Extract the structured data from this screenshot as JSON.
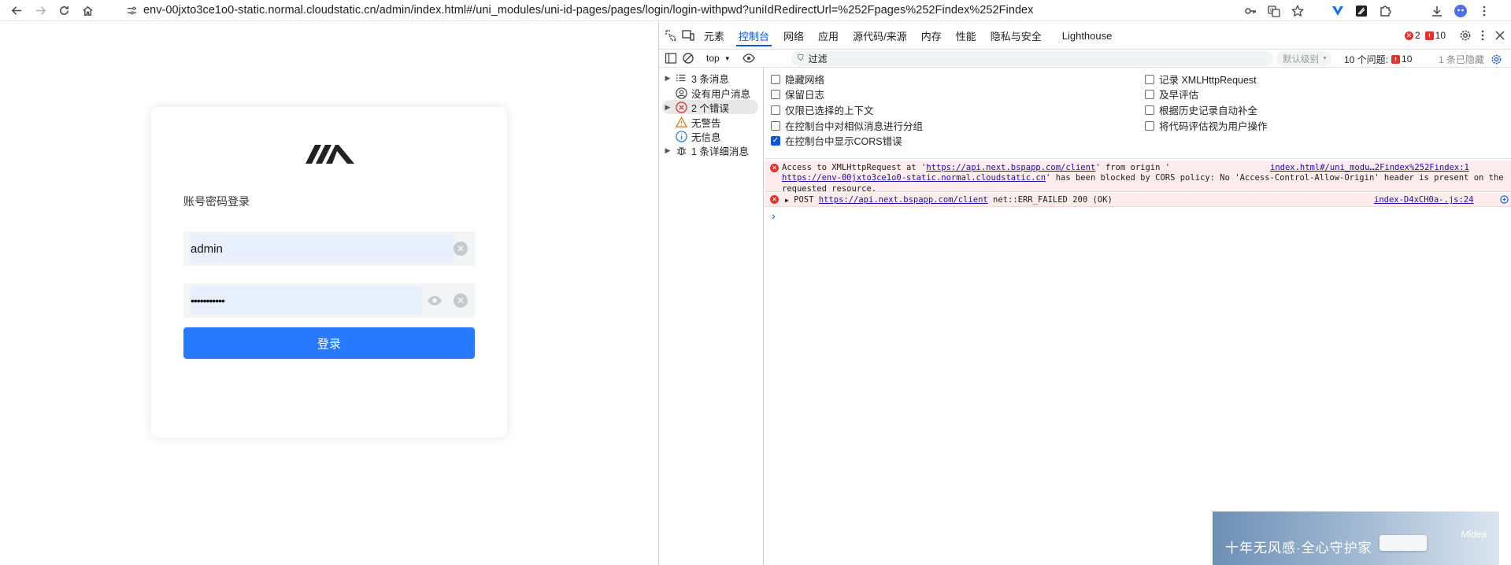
{
  "browser": {
    "url": "env-00jxto3ce1o0-static.normal.cloudstatic.cn/admin/index.html#/uni_modules/uni-id-pages/pages/login/login-withpwd?uniIdRedirectUrl=%252Fpages%252Findex%252Findex",
    "toolbar_icons": [
      "back-icon",
      "forward-icon",
      "reload-icon",
      "home-icon",
      "site-info-icon",
      "password-key-icon",
      "translate-icon",
      "bookmark-star-icon",
      "extension-v-icon",
      "extension-edit-icon",
      "extensions-puzzle-icon",
      "download-icon",
      "profile-avatar-icon",
      "menu-icon"
    ]
  },
  "login": {
    "title": "账号密码登录",
    "username_value": "admin",
    "password_value": "•••••••••••",
    "button_label": "登录",
    "accent_color": "#2979ff"
  },
  "devtools": {
    "tabs": [
      {
        "label": "元素",
        "active": false
      },
      {
        "label": "控制台",
        "active": true
      },
      {
        "label": "网络",
        "active": false
      },
      {
        "label": "应用",
        "active": false
      },
      {
        "label": "源代码/来源",
        "active": false
      },
      {
        "label": "内存",
        "active": false
      },
      {
        "label": "性能",
        "active": false
      },
      {
        "label": "隐私与安全",
        "active": false
      },
      {
        "label": "Lighthouse",
        "active": false
      }
    ],
    "error_count": "2",
    "warning_count": "10",
    "context": "top",
    "filter_placeholder": "过滤",
    "level_label": "默认级别",
    "issues_label": "10 个问题:",
    "issues_count": "10",
    "hidden_label": "1 条已隐藏",
    "sidebar": [
      {
        "label": "3 条消息",
        "icon": "list-icon",
        "expandable": true
      },
      {
        "label": "没有用户消息",
        "icon": "user-icon",
        "expandable": false
      },
      {
        "label": "2 个错误",
        "icon": "error-icon",
        "expandable": true
      },
      {
        "label": "无警告",
        "icon": "warning-icon",
        "expandable": false
      },
      {
        "label": "无信息",
        "icon": "info-icon",
        "expandable": false
      },
      {
        "label": "1 条详细消息",
        "icon": "bug-icon",
        "expandable": true
      }
    ],
    "settings_left": [
      {
        "label": "隐藏网络",
        "checked": false
      },
      {
        "label": "保留日志",
        "checked": false
      },
      {
        "label": "仅限已选择的上下文",
        "checked": false
      },
      {
        "label": "在控制台中对相似消息进行分组",
        "checked": false
      },
      {
        "label": "在控制台中显示CORS错误",
        "checked": true
      }
    ],
    "settings_right": [
      {
        "label": "记录 XMLHttpRequest",
        "checked": false
      },
      {
        "label": "及早评估",
        "checked": false
      },
      {
        "label": "根据历史记录自动补全",
        "checked": false
      },
      {
        "label": "将代码评估视为用户操作",
        "checked": false
      }
    ],
    "messages": {
      "cors": {
        "part1": "Access to XMLHttpRequest at '",
        "link1": "https://api.next.bspapp.com/client",
        "part2": "' from origin '",
        "link2": "https://env-00jxto3ce1o0-static.normal.cloudstatic.cn",
        "part3": "' has been blocked by CORS policy: No 'Access-Control-Allow-Origin' header is present on the requested resource.",
        "source": "index.html#/uni_modu…2Findex%252Findex:1"
      },
      "post": {
        "prefix": "POST",
        "link": "https://api.next.bspapp.com/client",
        "suffix": "net::ERR_FAILED 200 (OK)",
        "source": "index-D4xCH0a-.js:24"
      }
    }
  },
  "ad": {
    "slogan": "十年无风感·全心守护家",
    "brand": "Midea"
  }
}
